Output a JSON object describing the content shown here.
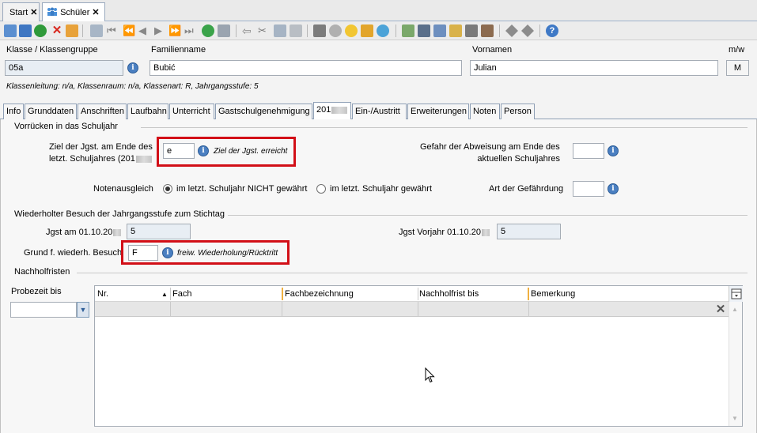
{
  "doc_tabs": [
    {
      "label": "Start",
      "close": "✕"
    },
    {
      "label": "Schüler",
      "close": "✕"
    }
  ],
  "header": {
    "klasse_label": "Klasse / Klassengruppe",
    "klasse_value": "05a",
    "familienname_label": "Familienname",
    "familienname_value": "Bubić",
    "vornamen_label": "Vornamen",
    "vornamen_value": "Julian",
    "mw_label": "m/w",
    "mw_value": "M",
    "info_line": "Klassenleitung: n/a, Klassenraum: n/a, Klassenart: R, Jahrgangsstufe: 5"
  },
  "page_tabs": [
    "Info",
    "Grunddaten",
    "Anschriften",
    "Laufbahn",
    "Unterricht",
    "Gastschulgenehmigung",
    "201",
    "Ein-/Austritt",
    "Erweiterungen",
    "Noten",
    "Person"
  ],
  "vorruecken": {
    "title": "Vorrücken in das Schuljahr",
    "ziel_label_1": "Ziel der Jgst. am Ende des",
    "ziel_label_2": "letzt. Schuljahres (201",
    "ziel_value": "e",
    "ziel_hint": "Ziel der Jgst. erreicht",
    "gefahr_label_1": "Gefahr der Abweisung am Ende des",
    "gefahr_label_2": "aktuellen Schuljahres",
    "gefahr_value": "",
    "notenausgleich_label": "Notenausgleich",
    "radio_nicht": "im letzt. Schuljahr NICHT gewährt",
    "radio_gewaehrt": "im letzt. Schuljahr gewährt",
    "gefaehrdung_label": "Art der Gefährdung",
    "gefaehrdung_value": ""
  },
  "wiederholt": {
    "title": "Wiederholter Besuch der Jahrgangsstufe zum Stichtag",
    "jgst_label": "Jgst am 01.10.20",
    "jgst_value": "5",
    "vorjahr_label": "Jgst Vorjahr 01.10.20",
    "vorjahr_value": "5",
    "grund_label": "Grund f. wiederh. Besuch",
    "grund_value": "F",
    "grund_hint": "freiw. Wiederholung/Rücktritt"
  },
  "nachhol": {
    "title": "Nachholfristen",
    "probezeit_label": "Probezeit bis",
    "probezeit_value": "",
    "columns": [
      "Nr.",
      "Fach",
      "Fachbezeichnung",
      "Nachholfrist bis",
      "Bemerkung"
    ],
    "sort_arrow": "▲",
    "clear_glyph": "✕"
  },
  "colors": {
    "highlight": "#d20f17",
    "info_icon": "#4a7fc1",
    "readonly_field": "#e8eef4",
    "column_separator": "#f0b040"
  }
}
